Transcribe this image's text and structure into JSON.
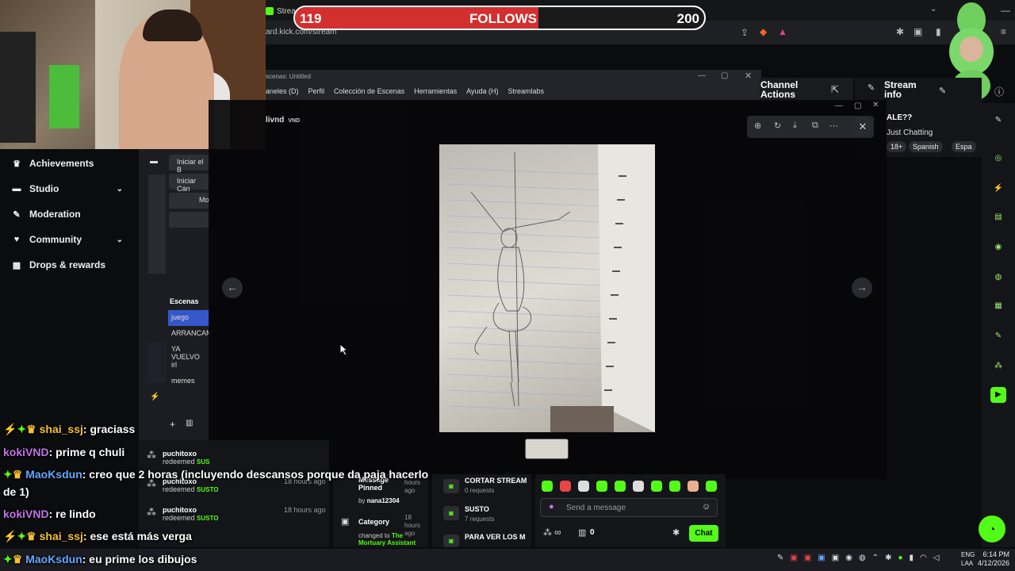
{
  "browser": {
    "tab_title": "Strea",
    "url": "ard.kick.com/stream"
  },
  "follows_goal": {
    "current": "119",
    "label": "FOLLOWS",
    "target": "200",
    "progress": 0.595,
    "fill_color": "#d32f2f"
  },
  "left_nav": {
    "items": [
      {
        "label": "Achievements",
        "icon": "trophy-icon",
        "expandable": false
      },
      {
        "label": "Studio",
        "icon": "studio-icon",
        "expandable": true
      },
      {
        "label": "Moderation",
        "icon": "wrench-icon",
        "expandable": false
      },
      {
        "label": "Community",
        "icon": "community-icon",
        "expandable": true
      },
      {
        "label": "Drops & rewards",
        "icon": "gift-icon",
        "expandable": false
      }
    ]
  },
  "obs": {
    "window_title": "scenas: Untitled",
    "menu": [
      "aneles (D)",
      "Perfil",
      "Colección de Escenas",
      "Herramientas",
      "Ayuda (H)",
      "Streamlabs"
    ],
    "buttons": [
      "Iniciar el B",
      "Iniciar Cán",
      "Mo"
    ],
    "scenes_header": "Escenas",
    "scenes": [
      "juego",
      "ARRANCAM",
      "YA VUELVO",
      "irl",
      "memes"
    ],
    "selected_scene": "juego"
  },
  "dashboard": {
    "channel_actions": "Channel Actions",
    "stream_info": {
      "title": "Stream info",
      "stream_title": "ALE??",
      "category": "Just Chatting",
      "tags": [
        "18+",
        "Spanish",
        "Espa"
      ]
    }
  },
  "viewer": {
    "user": "livnd",
    "badge": "VND",
    "tools": [
      "zoom-in-icon",
      "rotate-icon",
      "download-icon",
      "open-external-icon",
      "more-icon"
    ]
  },
  "chat_overlay": [
    {
      "user": "shai_ssj",
      "text": ": graciass",
      "color": "#f6c230",
      "badges": "⚡✦♛"
    },
    {
      "user": "kokiVND",
      "text": ": prime q chuli",
      "color": "#c074e6",
      "badges": ""
    },
    {
      "user": "MaoKsdun",
      "text": ": creo que 2 horas (incluyendo descansos porque da paja hacerlo",
      "color": "#64a8ff",
      "badges": "✦♛"
    },
    {
      "user": "",
      "text": "de 1)",
      "color": "#ffffff",
      "badges": ""
    },
    {
      "user": "kokiVND",
      "text": ": re lindo",
      "color": "#c074e6",
      "badges": ""
    },
    {
      "user": "shai_ssj",
      "text": ": ese está más verga",
      "color": "#f6c230",
      "badges": "⚡✦♛"
    },
    {
      "user": "MaoKsdun",
      "text": ": eu prime los dibujos",
      "color": "#64a8ff",
      "badges": "✦♛"
    }
  ],
  "activity_feed": [
    {
      "user": "puchitoxo",
      "action": "redeemed",
      "reward": "SUS",
      "time": ""
    },
    {
      "user": "puchitoxo",
      "action": "redeemed",
      "reward": "SUSTO",
      "time": "18 hours ago"
    },
    {
      "user": "puchitoxo",
      "action": "redeemed",
      "reward": "SUSTO",
      "time": "18 hours ago"
    }
  ],
  "pinned": {
    "msg_title": "Message Pinned",
    "msg_by": "by",
    "msg_user": "nana12304",
    "msg_time": "hours ago",
    "cat_title": "Category",
    "cat_time": "18 hours ago",
    "cat_text": "changed to",
    "cat_value": "The Mortuary Assistant"
  },
  "requests": [
    {
      "title": "CORTAR STREAM",
      "count": "0 requests"
    },
    {
      "title": "SUSTO",
      "count": "7 requests"
    },
    {
      "title": "PARA VER LOS M",
      "count": ""
    }
  ],
  "chat_panel": {
    "placeholder": "Send a message",
    "infinity": "∞",
    "count": "0",
    "send_label": "Chat"
  },
  "taskbar": {
    "lang1": "ENG",
    "lang2": "LAA",
    "time": "6:14 PM",
    "date": "4/12/2026"
  }
}
